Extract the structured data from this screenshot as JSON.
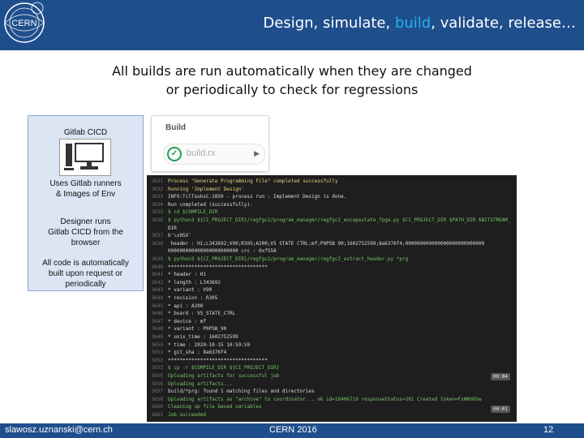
{
  "header": {
    "title_part1": "Design, simulate, ",
    "title_highlight": "build",
    "title_part2": ", validate, release…",
    "logo_text": "CERN"
  },
  "subtitle": {
    "line1": "All builds are run automatically when they are changed",
    "line2": "or periodically to check for regressions"
  },
  "gitlab_panel": {
    "title": "Gitlab CICD",
    "line1a": "Uses Gitlab runners",
    "line1b": "& Images of Env",
    "line2a": "Designer runs",
    "line2b": "Gitlab CICD from the",
    "line2c": "browser",
    "line3a": "All code is automatically",
    "line3b": "built upon request or",
    "line3c": "periodically",
    "icon": "monitor-icon"
  },
  "build_card": {
    "header": "Build",
    "job_name": "build.rx",
    "status_icon": "check-circle-icon"
  },
  "terminal": {
    "lines": [
      {
        "n": "3631",
        "t": "Process \"Generate Programming File\" completed successfully"
      },
      {
        "n": "3632",
        "t": "Running 'Implement Design'"
      },
      {
        "n": "3633",
        "t": "INFO:TclTasksC:1850 - process run : Implement Design is done."
      },
      {
        "n": "3634",
        "t": "Run completed (successfully)."
      },
      {
        "n": "3635",
        "t": "$ cd $COMPILE_DIR"
      },
      {
        "n": "3636",
        "t": "$ python3 ${CI_PROJECT_DIR}/regfgc2/program_manager/regfgc2_encapsulate_fpga.py $CI_PROJECT_DIR $PATH_DIR $BITSTREAM_"
      },
      {
        "n": "",
        "t": "DIR"
      },
      {
        "n": "3637",
        "t": "b'\\x05X'"
      },
      {
        "n": "3638",
        "t": "   header : H1;L343692;V90;R305;A200;V5 STATE CTRL;mf;P0PSB 90;1602752599;8a6376f4;000000000000000000000000000"
      },
      {
        "n": "",
        "t": "000000000000000000000000            crc : 0xf558"
      },
      {
        "n": "3639",
        "t": "$ python3 ${CI_PROJECT_DIR}/regfgc2/program_manager/regfgc2_extract_header.py *prg"
      },
      {
        "n": "3640",
        "t": "**********************************"
      },
      {
        "n": "3641",
        "t": "*  header    : H1"
      },
      {
        "n": "3642",
        "t": "*  length    : L343692"
      },
      {
        "n": "3643",
        "t": "*  variant   : V90"
      },
      {
        "n": "3644",
        "t": "*  revision  : R305"
      },
      {
        "n": "3645",
        "t": "*  api       : A200"
      },
      {
        "n": "3646",
        "t": "*  board     : VS_STATE_CTRL"
      },
      {
        "n": "3647",
        "t": "*  device    : mf"
      },
      {
        "n": "3648",
        "t": "*  variant   : P0PSB_90"
      },
      {
        "n": "3649",
        "t": "*  unix_time : 1602752599"
      },
      {
        "n": "3650",
        "t": "*  time      : 2020-10-15 10:59:59"
      },
      {
        "n": "3651",
        "t": "*  git_sha   : 8a6376f4"
      },
      {
        "n": "3652",
        "t": "**********************************"
      },
      {
        "n": "3653",
        "t": "$ cp -r $COMPILE_DIR ${CI_PROJECT_DIR}"
      },
      {
        "n": "3655",
        "t": "Uploading artifacts for successful job"
      },
      {
        "n": "3656",
        "t": "Uploading artifacts..."
      },
      {
        "n": "3657",
        "t": "build/*prg: found 1 matching files and directories"
      },
      {
        "n": "3658",
        "t": "Uploading artifacts as \"archive\" to coordinator... ok   id=16406719 responseStatus=201 Created token=FxWKHGhw"
      },
      {
        "n": "3660",
        "t": "Cleaning up file based variables"
      },
      {
        "n": "3662",
        "t": "Job succeeded"
      }
    ],
    "badge1": "00:04",
    "badge2": "00:01"
  },
  "footer": {
    "email": "slawosz.uznanski@cern.ch",
    "event": "CERN 2016",
    "page": "12"
  },
  "colors": {
    "header_bg": "#1f4e8c",
    "highlight": "#22b3e6",
    "panel_bg": "#dbe5f3",
    "terminal_bg": "#1e1e1e",
    "success_green": "#1f9e55"
  }
}
